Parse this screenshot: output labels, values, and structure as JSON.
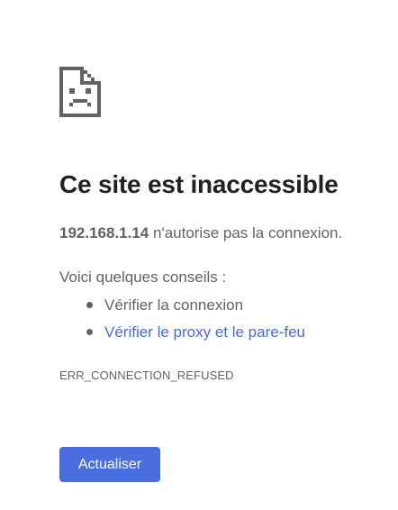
{
  "error_page": {
    "icon": "sad-page-icon",
    "title": "Ce site est inaccessible",
    "host": "192.168.1.14",
    "message_suffix": " n'autorise pas la connexion.",
    "suggestions_heading": "Voici quelques conseils :",
    "suggestions": [
      {
        "label": "Vérifier la connexion",
        "is_link": false
      },
      {
        "label": "Vérifier le proxy et le pare-feu",
        "is_link": true
      }
    ],
    "error_code": "ERR_CONNECTION_REFUSED",
    "reload_label": "Actualiser"
  },
  "colors": {
    "text_primary": "#202124",
    "text_secondary": "#5f6368",
    "link": "#4a6dd3",
    "button": "#4a6ee0"
  }
}
